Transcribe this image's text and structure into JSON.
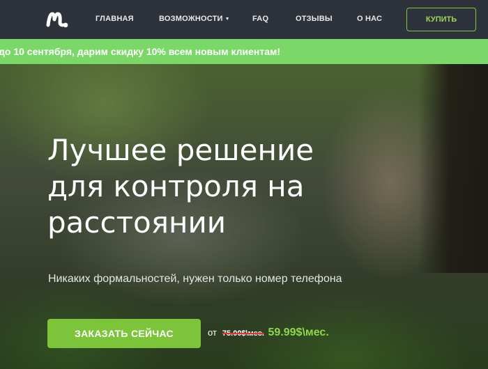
{
  "nav": {
    "logo_icon": "mspy-logo",
    "links": [
      {
        "label": "ГЛАВНАЯ"
      },
      {
        "label": "ВОЗМОЖНОСТИ",
        "has_dropdown": true
      },
      {
        "label": "FAQ"
      },
      {
        "label": "ОТЗЫВЫ"
      },
      {
        "label": "О НАС"
      }
    ],
    "buy_label": "КУПИТЬ"
  },
  "promo": {
    "text": "до 10 сентября, дарим скидку 10% всем новым клиентам!"
  },
  "hero": {
    "headline_lines": [
      "Лучшее решение",
      "для контроля на",
      "расстоянии"
    ],
    "subtitle": "Никаких формальностей, нужен только номер телефона",
    "order_label": "ЗАКАЗАТЬ СЕЙЧАС",
    "price_from": "от",
    "price_old": "75.00$\\мес.",
    "price_new": "59.99$\\мес."
  },
  "colors": {
    "nav_bg": "#2e333b",
    "promo_bg": "#7bd868",
    "accent_green": "#7cc43a",
    "strike_red": "#e83030"
  }
}
